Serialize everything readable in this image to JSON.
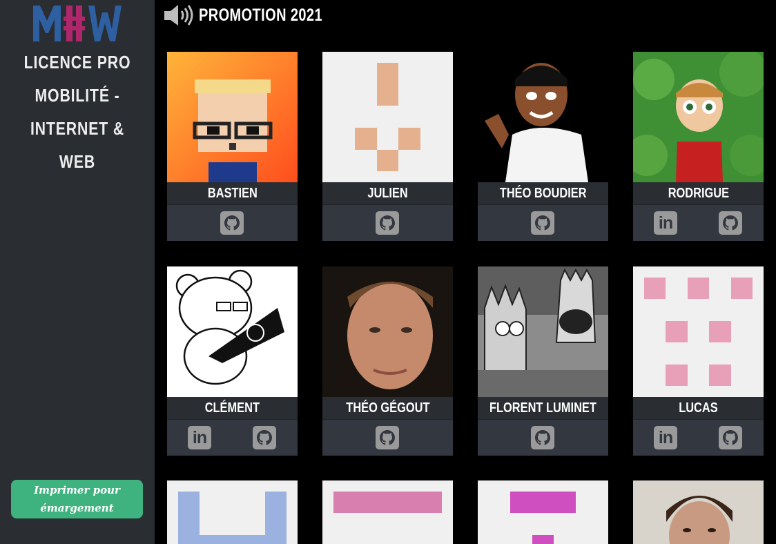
{
  "sidebar": {
    "logo_text": "MIW",
    "subtitle_lines": [
      "LICENCE PRO",
      "MOBILITÉ -",
      "INTERNET & WEB"
    ],
    "print_button_label": "Imprimer pour émargement",
    "print_button_color": "#3fb37f"
  },
  "header": {
    "icon": "speaker-icon",
    "title": "PROMOTION 2021"
  },
  "students": [
    {
      "name": "BASTIEN",
      "links": [
        "github"
      ]
    },
    {
      "name": "JULIEN",
      "links": [
        "github"
      ]
    },
    {
      "name": "THÉO BOUDIER",
      "links": [
        "github"
      ]
    },
    {
      "name": "RODRIGUE",
      "links": [
        "linkedin",
        "github"
      ]
    },
    {
      "name": "CLÉMENT",
      "links": [
        "linkedin",
        "github"
      ]
    },
    {
      "name": "THÉO GÉGOUT",
      "links": [
        "github"
      ]
    },
    {
      "name": "FLORENT LUMINET",
      "links": [
        "github"
      ]
    },
    {
      "name": "LUCAS",
      "links": [
        "linkedin",
        "github"
      ]
    },
    {
      "name": "",
      "links": []
    },
    {
      "name": "",
      "links": []
    },
    {
      "name": "",
      "links": []
    },
    {
      "name": "",
      "links": []
    }
  ],
  "colors": {
    "background": "#000000",
    "sidebar": "#2a2d32",
    "card_footer": "#333740",
    "icon_button": "#9a9a9a",
    "logo_blue": "#2e5fa1",
    "logo_magenta": "#b0266b"
  }
}
